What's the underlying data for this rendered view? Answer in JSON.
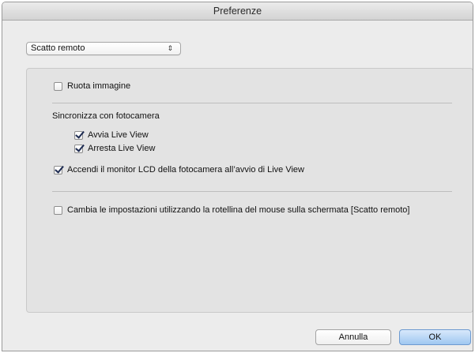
{
  "window": {
    "title": "Preferenze"
  },
  "category_select": {
    "value": "Scatto remoto",
    "arrows": "⇕"
  },
  "options": {
    "ruota_immagine": {
      "label": "Ruota immagine",
      "checked": false
    },
    "sync_heading": "Sincronizza con fotocamera",
    "avvia_live_view": {
      "label": "Avvia Live View",
      "checked": true
    },
    "arresta_live_view": {
      "label": "Arresta Live View",
      "checked": true
    },
    "accendi_monitor": {
      "label": "Accendi il monitor LCD della fotocamera all’avvio di Live View",
      "checked": true
    },
    "cambia_impostazioni": {
      "label": "Cambia le impostazioni utilizzando la rotellina del mouse sulla schermata [Scatto remoto]",
      "checked": false
    }
  },
  "buttons": {
    "cancel": "Annulla",
    "ok": "OK"
  }
}
